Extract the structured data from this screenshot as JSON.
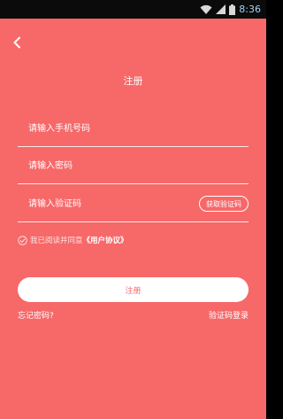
{
  "status_bar": {
    "time": "8:36",
    "icons": [
      "wifi-icon",
      "signal-icon",
      "battery-icon"
    ],
    "time_color": "#9fd3f3"
  },
  "header": {
    "back_icon": "chevron-left-icon",
    "title": "注册"
  },
  "form": {
    "phone_placeholder": "请输入手机号码",
    "phone_value": "",
    "password_placeholder": "请输入密码",
    "password_value": "",
    "code_placeholder": "请输入验证码",
    "code_value": "",
    "get_code_label": "获取验证码"
  },
  "agreement": {
    "prefix": "我已阅读并同意",
    "link_text": "《用户协议》",
    "checked": true
  },
  "actions": {
    "register_label": "注册",
    "forgot_password": "忘记密码?",
    "sms_login": "验证码登录"
  },
  "colors": {
    "background": "#f76869",
    "status_bar": "#0b0b0b",
    "text": "#ffffff"
  }
}
